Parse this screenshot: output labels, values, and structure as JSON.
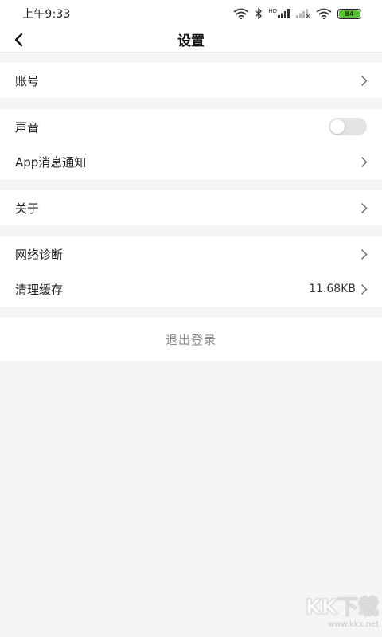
{
  "status_bar": {
    "time": "上午9:33",
    "network_label": "HD",
    "battery_level": "84"
  },
  "header": {
    "title": "设置"
  },
  "groups": [
    {
      "items": [
        {
          "label": "账号"
        }
      ]
    },
    {
      "items": [
        {
          "label": "声音",
          "toggle_on": false
        },
        {
          "label": "App消息通知"
        }
      ]
    },
    {
      "items": [
        {
          "label": "关于"
        }
      ]
    },
    {
      "items": [
        {
          "label": "网络诊断"
        },
        {
          "label": "清理缓存",
          "value": "11.68KB"
        }
      ]
    }
  ],
  "logout": {
    "label": "退出登录"
  },
  "watermark": {
    "mark": "KK下载",
    "url": "www.kkx.net"
  },
  "colors": {
    "background": "#f5f5f5",
    "surface": "#ffffff",
    "battery_fill": "#5bc236",
    "logout_text": "#8a8a8a"
  }
}
